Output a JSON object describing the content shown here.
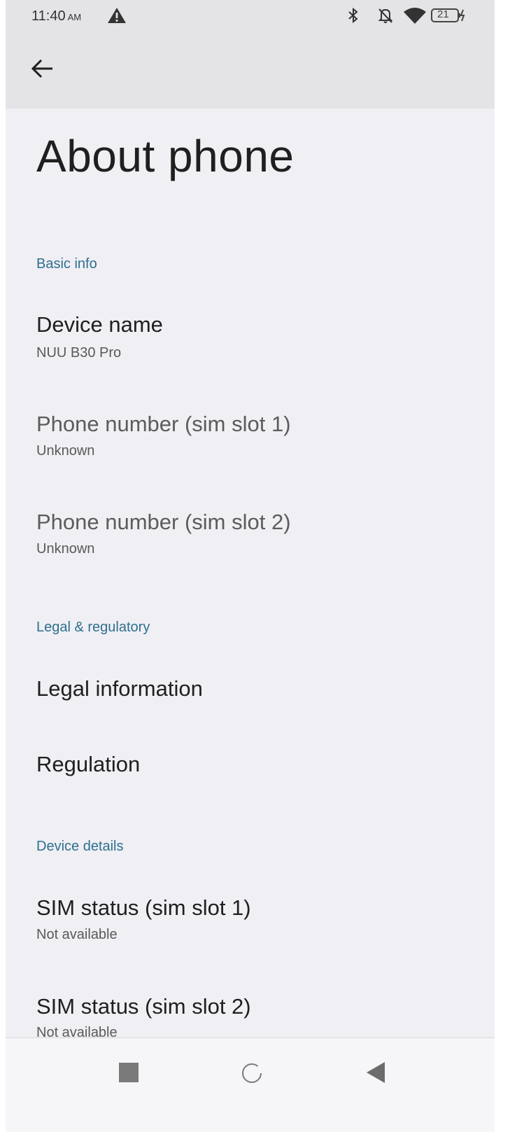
{
  "status_bar": {
    "time": "11:40",
    "ampm": "AM",
    "battery_level": "21",
    "icons": [
      "alert-triangle-icon",
      "bluetooth-icon",
      "notifications-muted-icon",
      "wifi-icon",
      "battery-charging-icon"
    ]
  },
  "app_bar": {
    "back_icon": "back-arrow-icon"
  },
  "page_title": "About phone",
  "sections": {
    "basic_info": {
      "header": "Basic info",
      "items": [
        {
          "title": "Device name",
          "subtitle": "NUU B30 Pro"
        },
        {
          "title": "Phone number (sim slot 1)",
          "subtitle": "Unknown"
        },
        {
          "title": "Phone number (sim slot 2)",
          "subtitle": "Unknown"
        }
      ]
    },
    "legal": {
      "header": "Legal & regulatory",
      "items": [
        {
          "title": "Legal information"
        },
        {
          "title": "Regulation"
        }
      ]
    },
    "device_details": {
      "header": "Device details",
      "items": [
        {
          "title": "SIM status (sim slot 1)",
          "subtitle": "Not available"
        },
        {
          "title": "SIM status (sim slot 2)",
          "subtitle": "Not available"
        }
      ]
    }
  },
  "nav_bar": {
    "buttons": [
      "recents-square-icon",
      "home-circle-icon",
      "back-triangle-icon"
    ]
  }
}
